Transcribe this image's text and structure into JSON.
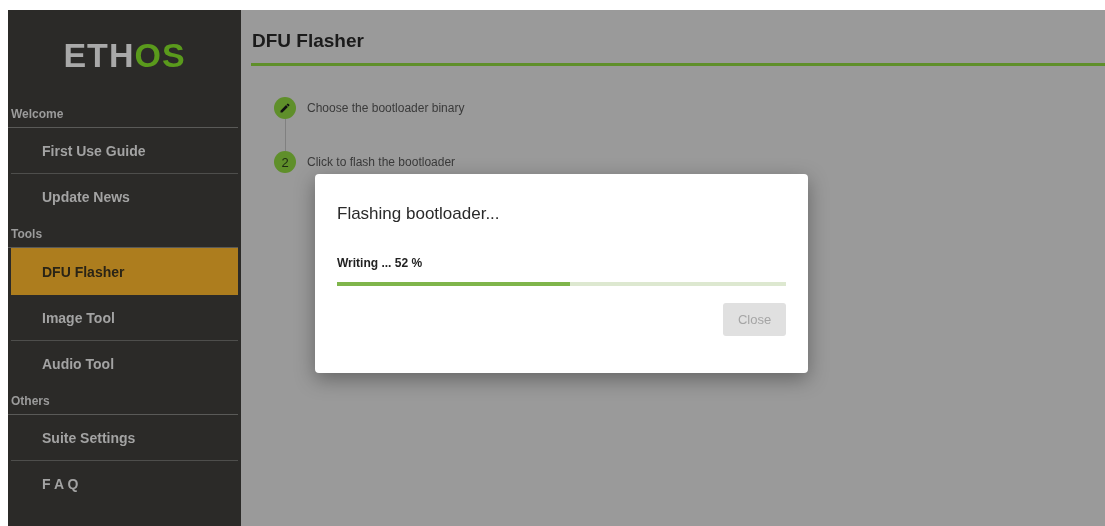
{
  "logo": {
    "parts": [
      {
        "text": "ETH",
        "kind": "plain"
      },
      {
        "text": "OS",
        "kind": "accent"
      }
    ]
  },
  "sidebar": {
    "sections": [
      {
        "title": "Welcome",
        "items": [
          {
            "label": "First Use Guide",
            "selected": false
          },
          {
            "label": "Update News",
            "selected": false
          }
        ]
      },
      {
        "title": "Tools",
        "items": [
          {
            "label": "DFU Flasher",
            "selected": true
          },
          {
            "label": "Image Tool",
            "selected": false
          },
          {
            "label": "Audio Tool",
            "selected": false
          }
        ]
      },
      {
        "title": "Others",
        "items": [
          {
            "label": "Suite Settings",
            "selected": false
          },
          {
            "label": "F A Q",
            "selected": false
          }
        ]
      }
    ]
  },
  "page": {
    "title": "DFU Flasher",
    "steps": [
      {
        "kind": "edit",
        "text": "Choose the bootloader binary"
      },
      {
        "kind": "number",
        "number": "2",
        "text": "Click to flash the bootloader"
      }
    ]
  },
  "dialog": {
    "title": "Flashing bootloader...",
    "status": "Writing ... 52 %",
    "level": 0.52,
    "button": {
      "label": "Close",
      "disabled": true
    }
  }
}
